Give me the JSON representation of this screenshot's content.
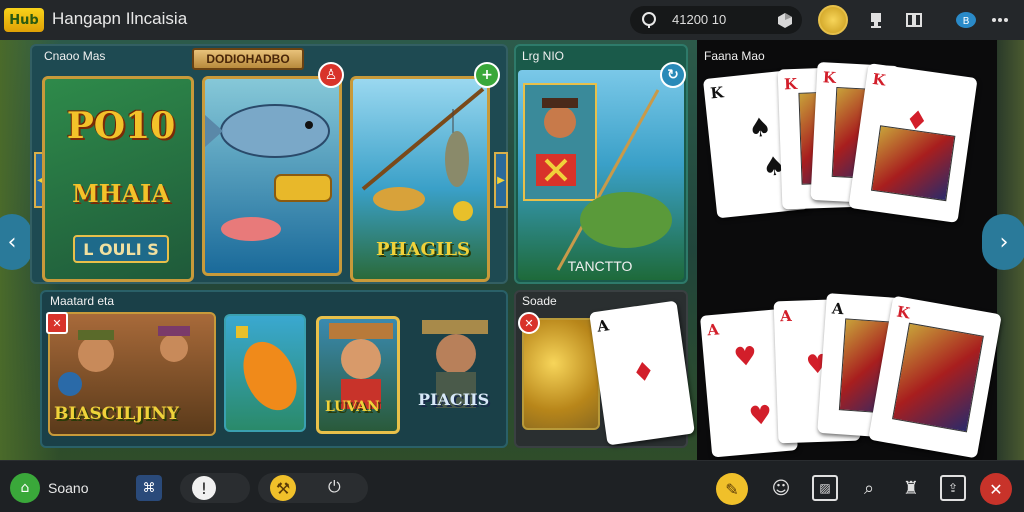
{
  "topbar": {
    "logo_text": "Hub",
    "title": "Hangapn Ilncaisia",
    "search_value": "41200 10",
    "icons": [
      "pin-icon",
      "cube-icon",
      "coin-avatar",
      "trophy-icon",
      "book-icon",
      "chat-icon",
      "more-icon"
    ]
  },
  "main": {
    "top_panel_label": "Cnaoo Mas",
    "banner": "DODIOHADBO",
    "tile_1": {
      "title": "PO10",
      "subtitle": "MHAIA",
      "button": "L OULI S"
    },
    "tile_3": {
      "title": "PHAGILS"
    },
    "top_right_panel_label": "Lrg NIO",
    "top_right_title": "TANCTTO",
    "bottom_panel_label": "Maatard eta",
    "thumbs": {
      "thumb_1_title": "BIASCILJINY",
      "thumb_3_title": "LUVAN",
      "thumb_4_title": "PIACIIS"
    },
    "bottom_right_panel_label": "Soade"
  },
  "cards_panel": {
    "label": "Faana Mao",
    "top_cards": [
      {
        "rank": "K",
        "suit": "♠",
        "color": "black"
      },
      {
        "rank": "K",
        "suit": "♦",
        "color": "red"
      },
      {
        "rank": "K",
        "suit": "♦",
        "color": "red"
      },
      {
        "rank": "K",
        "suit": "♦",
        "color": "red"
      }
    ],
    "bottom_cards": [
      {
        "rank": "A",
        "suit": "♥",
        "color": "red"
      },
      {
        "rank": "A",
        "suit": "♥",
        "color": "red"
      },
      {
        "rank": "A",
        "suit": "♠",
        "color": "black"
      },
      {
        "rank": "K",
        "suit": "♥",
        "color": "red"
      }
    ],
    "mid_card": {
      "rank": "A",
      "suit": "♦",
      "color": "red"
    }
  },
  "bottombar": {
    "home_label": "Soano"
  },
  "colors": {
    "gold": "#f0d23a",
    "accent_green": "#3aa83a",
    "accent_red": "#d8332a",
    "teal": "#2a7a9a"
  }
}
